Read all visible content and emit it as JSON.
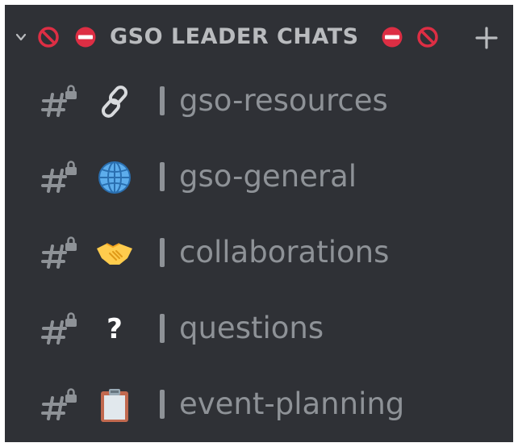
{
  "category": {
    "title": "GSO LEADER CHATS",
    "collapse_icon": "chevron-down-icon",
    "left_emojis": [
      "no-entry-sign-icon",
      "no-entry-icon"
    ],
    "right_emojis": [
      "no-entry-icon",
      "no-entry-sign-icon"
    ],
    "add_icon": "plus-icon"
  },
  "channels": [
    {
      "name": "gso-resources",
      "emoji": "link-icon",
      "icon": "locked-hash-icon"
    },
    {
      "name": "gso-general",
      "emoji": "globe-icon",
      "icon": "locked-hash-icon"
    },
    {
      "name": "collaborations",
      "emoji": "handshake-icon",
      "icon": "locked-hash-icon"
    },
    {
      "name": "questions",
      "emoji": "question-mark-icon",
      "emoji_text": "?",
      "icon": "locked-hash-icon"
    },
    {
      "name": "event-planning",
      "emoji": "clipboard-icon",
      "icon": "locked-hash-icon"
    }
  ],
  "colors": {
    "background": "#2f3136",
    "text_muted": "#8e9297",
    "header_text": "#b9bbbe",
    "no_entry_red": "#dd2e44"
  }
}
